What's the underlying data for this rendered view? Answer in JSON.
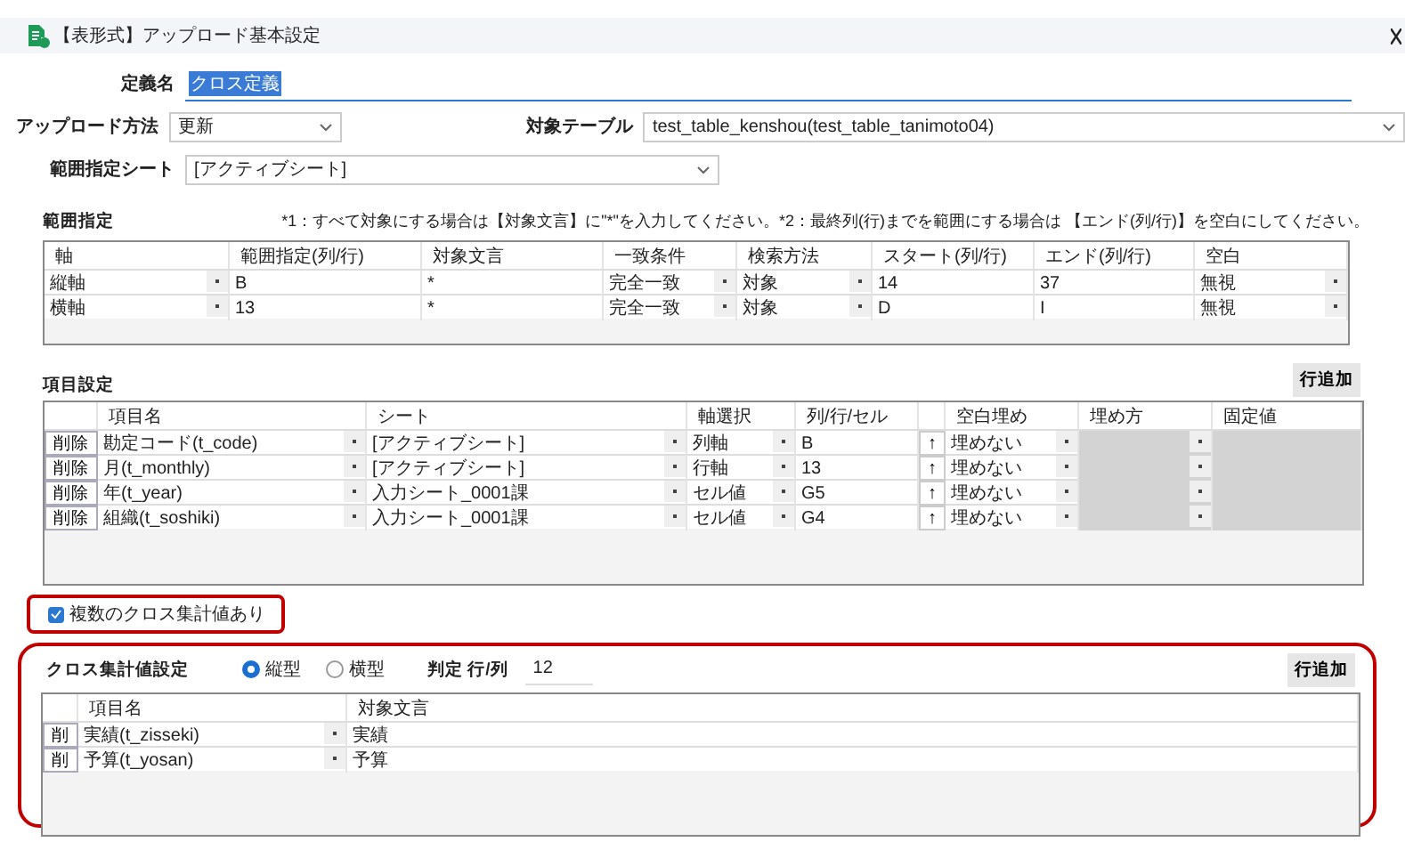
{
  "window": {
    "title": "【表形式】アップロード基本設定"
  },
  "form": {
    "definition_name": {
      "label": "定義名",
      "value": "クロス定義",
      "text_selected": true
    },
    "upload_method": {
      "label": "アップロード方法",
      "value": "更新"
    },
    "target_table": {
      "label": "対象テーブル",
      "value": "test_table_kenshou(test_table_tanimoto04)"
    },
    "range_sheet": {
      "label": "範囲指定シート",
      "value": "[アクティブシート]"
    }
  },
  "range": {
    "title": "範囲指定",
    "note": "*1：すべて対象にする場合は【対象文言】に\"*\"を入力してください。*2：最終列(行)までを範囲にする場合は 【エンド(列/行)】を空白にしてください。",
    "columns": [
      "軸",
      "範囲指定(列/行)",
      "対象文言",
      "一致条件",
      "検索方法",
      "スタート(列/行)",
      "エンド(列/行)",
      "空白"
    ],
    "rows": [
      [
        {
          "text": "縦軸",
          "kind": "select"
        },
        {
          "text": "B",
          "kind": "text"
        },
        {
          "text": "*",
          "kind": "text"
        },
        {
          "text": "完全一致",
          "kind": "select"
        },
        {
          "text": "対象",
          "kind": "select"
        },
        {
          "text": "14",
          "kind": "text"
        },
        {
          "text": "37",
          "kind": "text"
        },
        {
          "text": "無視",
          "kind": "select"
        }
      ],
      [
        {
          "text": "横軸",
          "kind": "select"
        },
        {
          "text": "13",
          "kind": "text"
        },
        {
          "text": "*",
          "kind": "text"
        },
        {
          "text": "完全一致",
          "kind": "select"
        },
        {
          "text": "対象",
          "kind": "select"
        },
        {
          "text": "D",
          "kind": "text"
        },
        {
          "text": "I",
          "kind": "text"
        },
        {
          "text": "無視",
          "kind": "select"
        }
      ]
    ]
  },
  "items": {
    "title": "項目設定",
    "add_button": "行追加",
    "columns": [
      "項目名",
      "シート",
      "軸選択",
      "列/行/セル",
      "",
      "空白埋め",
      "埋め方",
      "固定値"
    ],
    "rows": [
      {
        "delete": "削除",
        "cells": [
          {
            "text": "勘定コード(t_code)",
            "kind": "select"
          },
          {
            "text": "[アクティブシート]",
            "kind": "select"
          },
          {
            "text": "列軸",
            "kind": "select"
          },
          {
            "text": "B",
            "kind": "text"
          },
          {
            "text": "↑",
            "kind": "button"
          },
          {
            "text": "埋めない",
            "kind": "select"
          },
          {
            "kind": "select",
            "disabled": true
          },
          {
            "kind": "text",
            "disabled": true
          }
        ]
      },
      {
        "delete": "削除",
        "cells": [
          {
            "text": "月(t_monthly)",
            "kind": "select"
          },
          {
            "text": "[アクティブシート]",
            "kind": "select"
          },
          {
            "text": "行軸",
            "kind": "select"
          },
          {
            "text": "13",
            "kind": "text"
          },
          {
            "text": "↑",
            "kind": "button"
          },
          {
            "text": "埋めない",
            "kind": "select"
          },
          {
            "kind": "select",
            "disabled": true
          },
          {
            "kind": "text",
            "disabled": true
          }
        ]
      },
      {
        "delete": "削除",
        "cells": [
          {
            "text": "年(t_year)",
            "kind": "select"
          },
          {
            "text": "入力シート_0001課",
            "kind": "select"
          },
          {
            "text": "セル値",
            "kind": "select"
          },
          {
            "text": "G5",
            "kind": "text"
          },
          {
            "text": "↑",
            "kind": "button"
          },
          {
            "text": "埋めない",
            "kind": "select"
          },
          {
            "kind": "select",
            "disabled": true
          },
          {
            "kind": "text",
            "disabled": true
          }
        ]
      },
      {
        "delete": "削除",
        "cells": [
          {
            "text": "組織(t_soshiki)",
            "kind": "select"
          },
          {
            "text": "入力シート_0001課",
            "kind": "select"
          },
          {
            "text": "セル値",
            "kind": "select"
          },
          {
            "text": "G4",
            "kind": "text"
          },
          {
            "text": "↑",
            "kind": "button"
          },
          {
            "text": "埋めない",
            "kind": "select"
          },
          {
            "kind": "select",
            "disabled": true
          },
          {
            "kind": "text",
            "disabled": true
          }
        ]
      }
    ]
  },
  "multi_cross": {
    "label": "複数のクロス集計値あり",
    "checked": true
  },
  "cross": {
    "title": "クロス集計値設定",
    "orientation": [
      {
        "label": "縦型",
        "selected": true
      },
      {
        "label": "横型",
        "selected": false
      }
    ],
    "judge_label": "判定 行/列",
    "judge_value": "12",
    "add_button": "行追加",
    "columns": [
      "項目名",
      "対象文言"
    ],
    "rows": [
      {
        "delete": "削",
        "cells": [
          {
            "text": "実績(t_zisseki)",
            "kind": "select"
          },
          {
            "text": "実績",
            "kind": "text"
          }
        ]
      },
      {
        "delete": "削",
        "cells": [
          {
            "text": "予算(t_yosan)",
            "kind": "select"
          },
          {
            "text": "予算",
            "kind": "text"
          }
        ]
      }
    ]
  }
}
